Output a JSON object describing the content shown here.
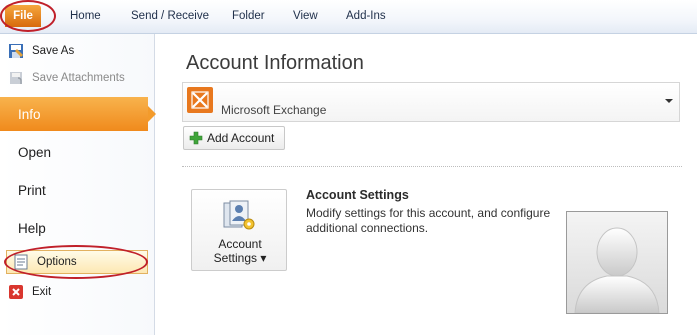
{
  "ribbon": {
    "file_tab": "File",
    "tabs": [
      "Home",
      "Send / Receive",
      "Folder",
      "View",
      "Add-Ins"
    ]
  },
  "backstage": {
    "commands_top": [
      {
        "label": "Save As",
        "icon": "save-as-icon",
        "enabled": true
      },
      {
        "label": "Save Attachments",
        "icon": "save-attachments-icon",
        "enabled": false
      }
    ],
    "nav_tabs": [
      {
        "label": "Info",
        "active": true
      },
      {
        "label": "Open",
        "active": false
      },
      {
        "label": "Print",
        "active": false
      },
      {
        "label": "Help",
        "active": false
      }
    ],
    "options_label": "Options",
    "exit_label": "Exit"
  },
  "main": {
    "title": "Account Information",
    "account_selector": {
      "value": "Microsoft Exchange",
      "icon": "exchange-icon"
    },
    "add_account_label": "Add Account",
    "account_settings": {
      "button_line1": "Account",
      "button_line2": "Settings ▾",
      "heading": "Account Settings",
      "description": "Modify settings for this account, and configure additional connections."
    },
    "profile_photo": "profile-placeholder-icon"
  },
  "colors": {
    "accent_orange": "#f08a1c",
    "highlight_red": "#c0202a",
    "ribbon_text": "#1f2f4a"
  }
}
